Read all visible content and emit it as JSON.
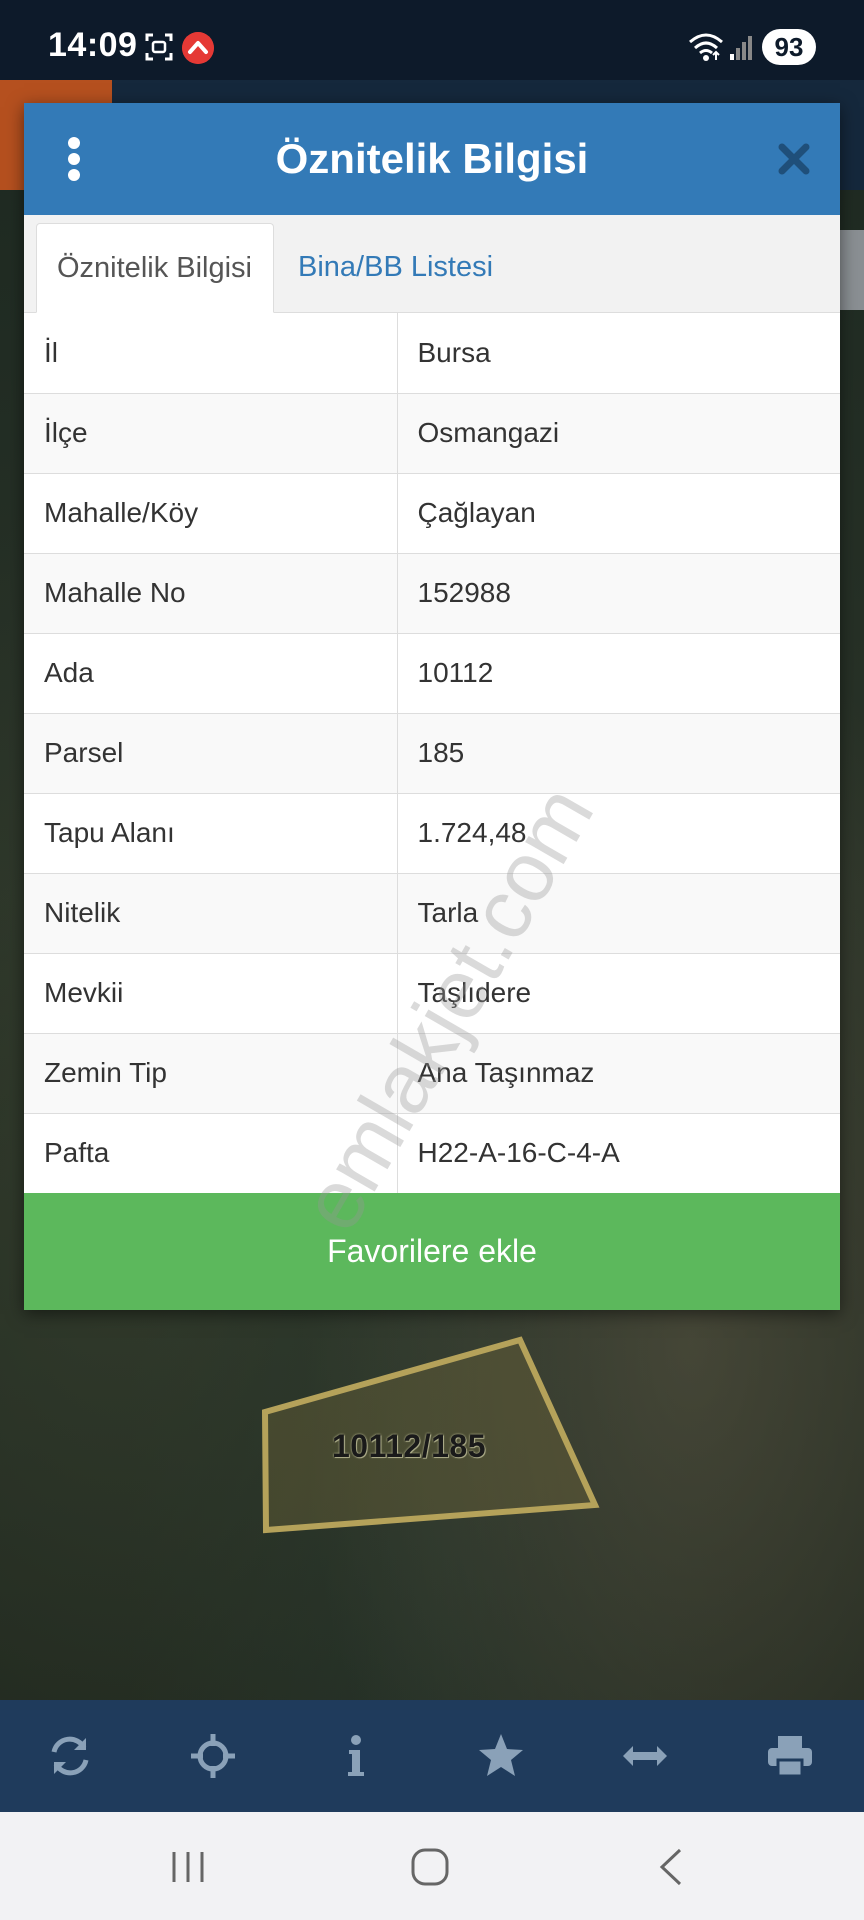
{
  "status_bar": {
    "time": "14:09",
    "battery": "93",
    "icons": [
      "screenshot-icon",
      "app-notification-icon",
      "wifi-icon",
      "signal-icon"
    ]
  },
  "map": {
    "parcel_label": "10112/185",
    "watermark": "emlakjet.com"
  },
  "modal": {
    "title": "Öznitelik Bilgisi",
    "tabs": [
      {
        "label": "Öznitelik Bilgisi",
        "active": true
      },
      {
        "label": "Bina/BB Listesi",
        "active": false
      }
    ],
    "rows": [
      {
        "key": "İl",
        "value": "Bursa"
      },
      {
        "key": "İlçe",
        "value": "Osmangazi"
      },
      {
        "key": "Mahalle/Köy",
        "value": "Çağlayan"
      },
      {
        "key": "Mahalle No",
        "value": "152988"
      },
      {
        "key": "Ada",
        "value": "10112"
      },
      {
        "key": "Parsel",
        "value": "185"
      },
      {
        "key": "Tapu Alanı",
        "value": "1.724,48"
      },
      {
        "key": "Nitelik",
        "value": "Tarla"
      },
      {
        "key": "Mevkii",
        "value": "Taşlıdere"
      },
      {
        "key": "Zemin Tip",
        "value": "Ana Taşınmaz"
      },
      {
        "key": "Pafta",
        "value": "H22-A-16-C-4-A"
      }
    ],
    "favorite_button": "Favorilere ekle"
  },
  "toolbar": {
    "icons": [
      "refresh-icon",
      "locate-icon",
      "info-icon",
      "star-icon",
      "measure-icon",
      "print-icon"
    ]
  },
  "colors": {
    "header": "#337ab7",
    "button_green": "#5cb85c",
    "toolbar": "#1f3b5c"
  }
}
